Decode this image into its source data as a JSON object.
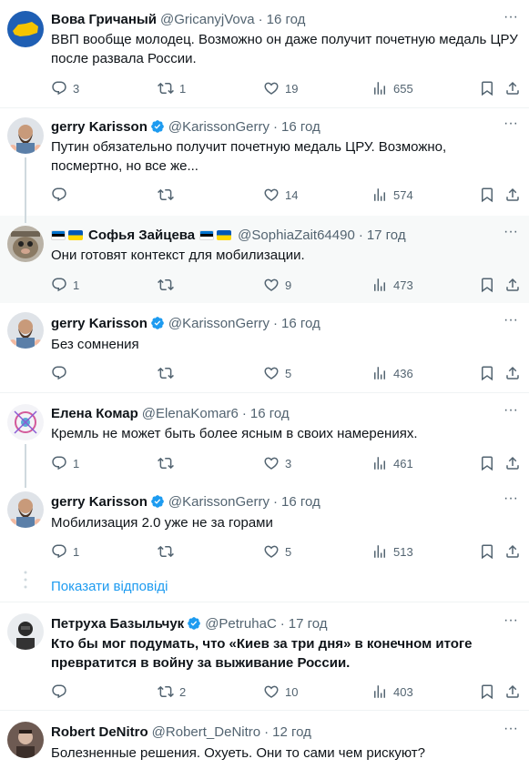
{
  "tweets": [
    {
      "name": "Вова Гричаный",
      "handle": "@GricanyjVova",
      "time": "16 год",
      "text": "ВВП вообще молодец. Возможно он даже получит почетную медаль ЦРУ после развала России.",
      "replies": "3",
      "retweets": "1",
      "likes": "19",
      "views": "655"
    },
    {
      "name": "gerry Karisson",
      "handle": "@KarissonGerry",
      "time": "16 год",
      "text": "Путин обязательно получит почетную медаль ЦРУ. Возможно, посмертно, но все же...",
      "replies": "",
      "retweets": "",
      "likes": "14",
      "views": "574"
    },
    {
      "name": "Софья Зайцева",
      "handle": "@SophiaZait64490",
      "time": "17 год",
      "text": "Они готовят контекст для мобилизации.",
      "replies": "1",
      "retweets": "",
      "likes": "9",
      "views": "473"
    },
    {
      "name": "gerry Karisson",
      "handle": "@KarissonGerry",
      "time": "16 год",
      "text": "Без сомнения",
      "replies": "",
      "retweets": "",
      "likes": "5",
      "views": "436"
    },
    {
      "name": "Елена Комар",
      "handle": "@ElenaKomar6",
      "time": "16 год",
      "text": "Кремль не может быть более ясным в своих намерениях.",
      "replies": "1",
      "retweets": "",
      "likes": "3",
      "views": "461"
    },
    {
      "name": "gerry Karisson",
      "handle": "@KarissonGerry",
      "time": "16 год",
      "text": "Мобилизация 2.0 уже не за горами",
      "replies": "1",
      "retweets": "",
      "likes": "5",
      "views": "513"
    },
    {
      "name": "Петруха Базыльчук",
      "handle": "@PetruhaC",
      "time": "17 год",
      "text": "Кто бы мог подумать, что «Киев за три дня» в конечном итоге превратится в войну за выживание России.",
      "replies": "",
      "retweets": "2",
      "likes": "10",
      "views": "403"
    },
    {
      "name": "Robert DeNitro",
      "handle": "@Robert_DeNitro",
      "time": "12 год",
      "text": "Болезненные решения. Охуеть. Они то сами чем рискуют?"
    }
  ],
  "show_replies_label": "Показати відповіді",
  "separator": "·",
  "colors": {
    "accent": "#1d9bf0",
    "muted": "#536471",
    "text": "#0f1419",
    "highlight_bg": "#f7f9f9"
  }
}
